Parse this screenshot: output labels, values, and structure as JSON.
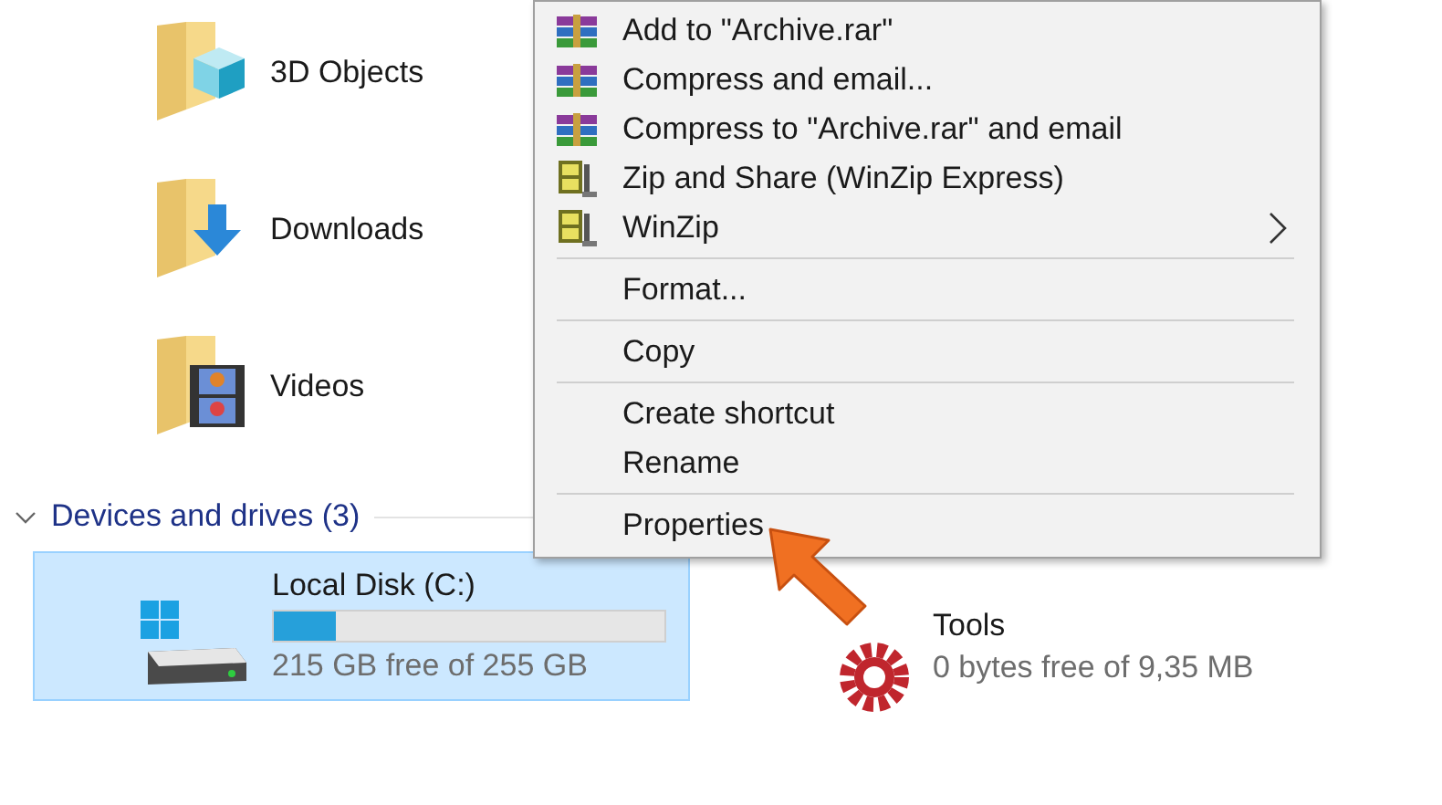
{
  "folders": [
    {
      "name": "3D Objects",
      "kind": "objects3d"
    },
    {
      "name": "Downloads",
      "kind": "downloads"
    },
    {
      "name": "Videos",
      "kind": "videos"
    }
  ],
  "devices_group": {
    "title": "Devices and drives (3)",
    "expanded": true
  },
  "drives": [
    {
      "name": "Local Disk (C:)",
      "kind": "system",
      "selected": true,
      "level": 0.16,
      "free": "215 GB free of 255 GB"
    },
    {
      "name": "Tools",
      "kind": "app",
      "selected": false,
      "free": "0 bytes free of 9,35 MB"
    }
  ],
  "context_menu": {
    "items": [
      {
        "kind": "rar",
        "label": "Add to \"Archive.rar\""
      },
      {
        "kind": "rar",
        "label": "Compress and email..."
      },
      {
        "kind": "rar",
        "label": "Compress to \"Archive.rar\" and email"
      },
      {
        "kind": "zip",
        "label": "Zip and Share (WinZip Express)"
      },
      {
        "kind": "zip",
        "label": "WinZip",
        "submenu": true
      },
      {
        "kind": "separator"
      },
      {
        "kind": "item",
        "label": "Format..."
      },
      {
        "kind": "separator"
      },
      {
        "kind": "item",
        "label": "Copy"
      },
      {
        "kind": "separator"
      },
      {
        "kind": "item",
        "label": "Create shortcut"
      },
      {
        "kind": "item",
        "label": "Rename"
      },
      {
        "kind": "separator"
      },
      {
        "kind": "item",
        "label": "Properties"
      }
    ]
  }
}
